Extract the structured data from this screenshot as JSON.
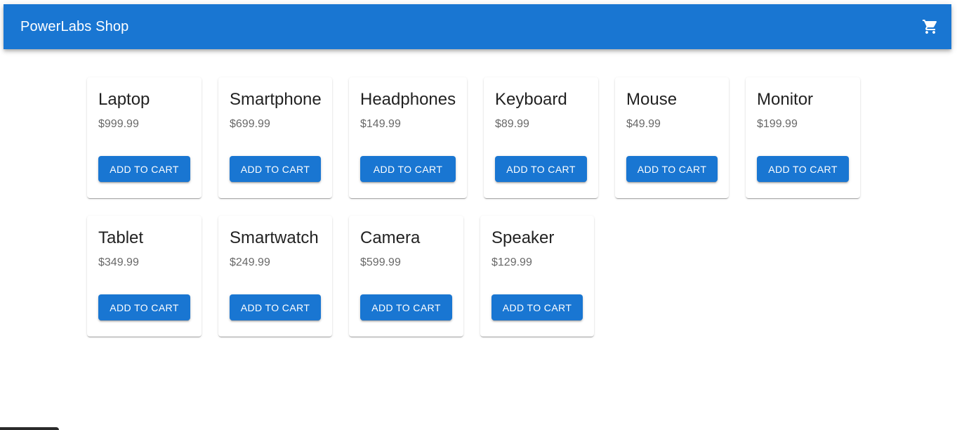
{
  "header": {
    "title": "PowerLabs Shop",
    "cart_icon": "shopping-cart-icon"
  },
  "products": [
    {
      "name": "Laptop",
      "price": "$999.99",
      "button": "ADD TO CART"
    },
    {
      "name": "Smartphone",
      "price": "$699.99",
      "button": "ADD TO CART"
    },
    {
      "name": "Headphones",
      "price": "$149.99",
      "button": "ADD TO CART"
    },
    {
      "name": "Keyboard",
      "price": "$89.99",
      "button": "ADD TO CART"
    },
    {
      "name": "Mouse",
      "price": "$49.99",
      "button": "ADD TO CART"
    },
    {
      "name": "Monitor",
      "price": "$199.99",
      "button": "ADD TO CART"
    },
    {
      "name": "Tablet",
      "price": "$349.99",
      "button": "ADD TO CART"
    },
    {
      "name": "Smartwatch",
      "price": "$249.99",
      "button": "ADD TO CART"
    },
    {
      "name": "Camera",
      "price": "$599.99",
      "button": "ADD TO CART"
    },
    {
      "name": "Speaker",
      "price": "$129.99",
      "button": "ADD TO CART"
    }
  ],
  "colors": {
    "primary": "#1976d2",
    "background": "#ffffff"
  }
}
